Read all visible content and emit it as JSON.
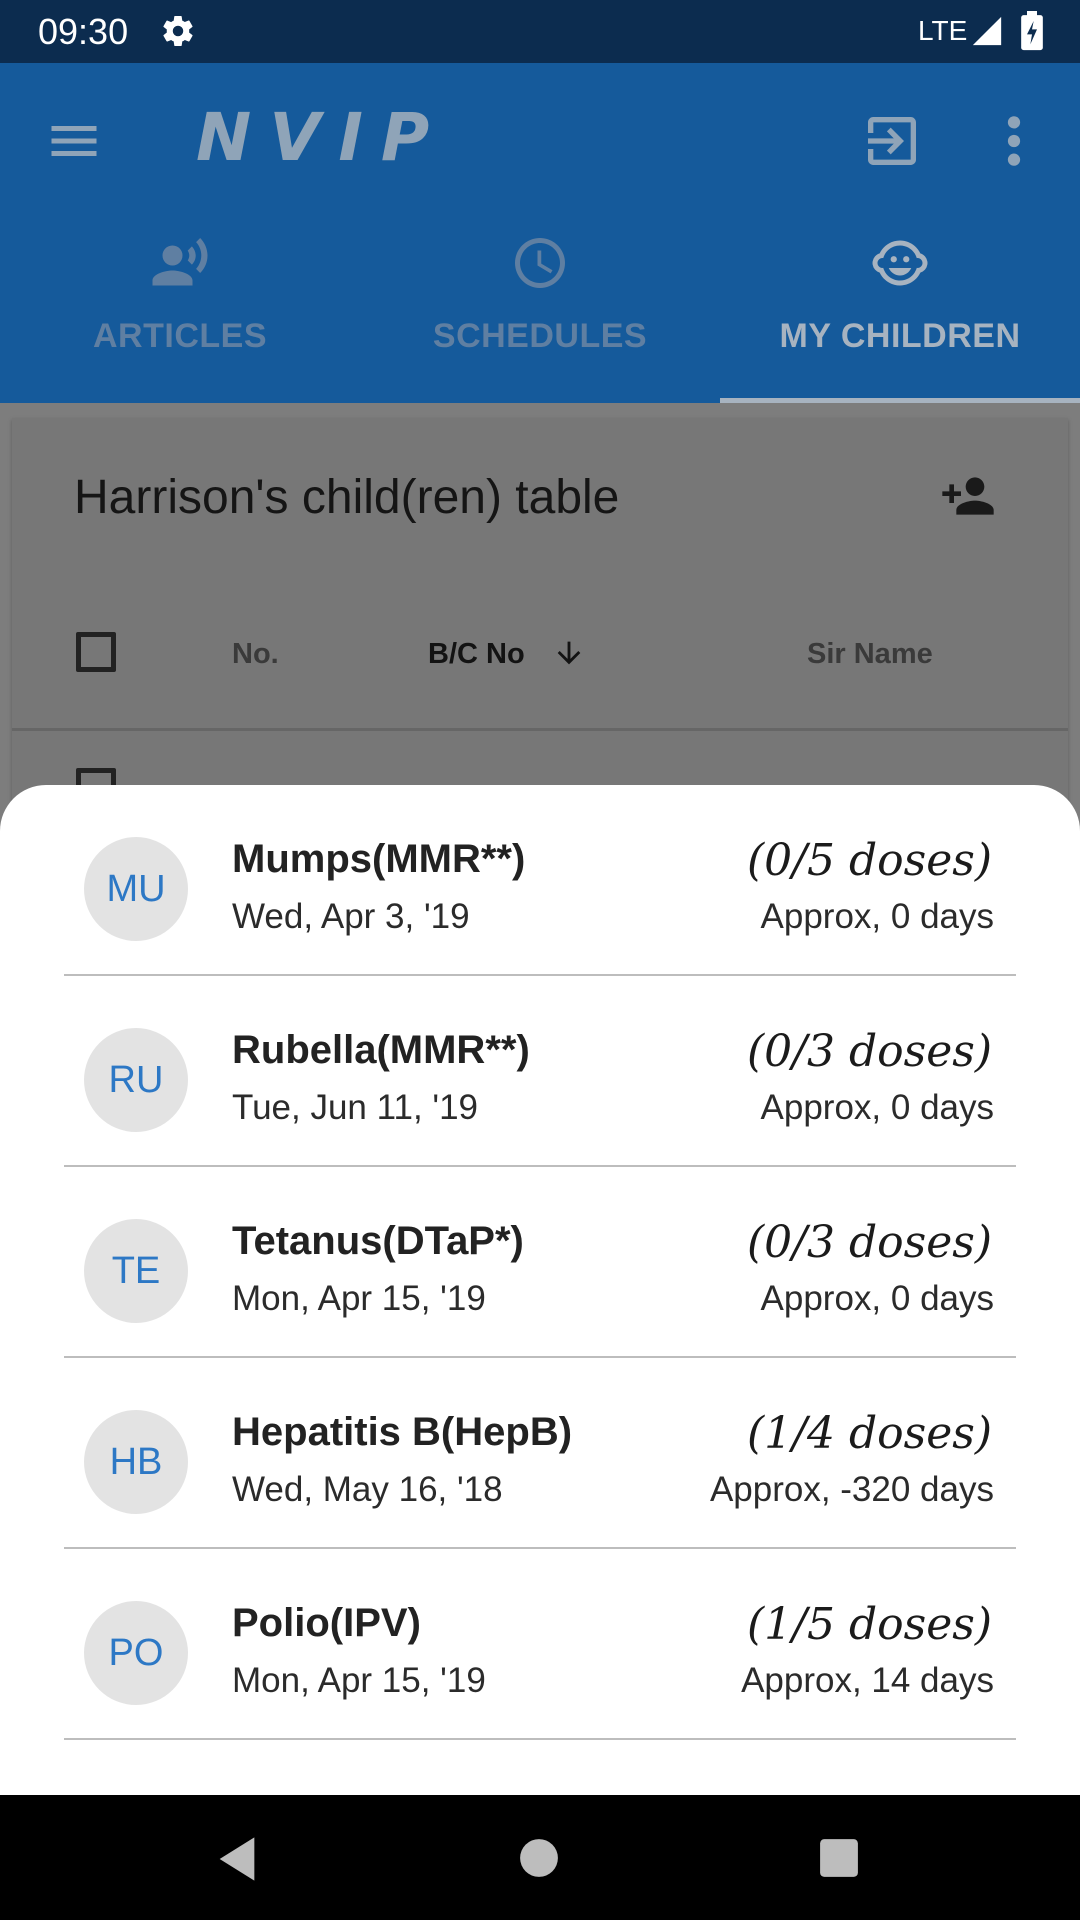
{
  "status_bar": {
    "time": "09:30",
    "network": "LTE",
    "icons": [
      "gear-icon",
      "signal-icon",
      "battery-icon"
    ]
  },
  "app_bar": {
    "logo": "NVIP",
    "icons": [
      "menu-icon",
      "logout-icon",
      "overflow-menu-icon"
    ]
  },
  "tabs": [
    {
      "label": "ARTICLES",
      "icon": "speaker-person-icon",
      "selected": false
    },
    {
      "label": "SCHEDULES",
      "icon": "clock-icon",
      "selected": false
    },
    {
      "label": "MY CHILDREN",
      "icon": "baby-face-icon",
      "selected": true
    }
  ],
  "card": {
    "title": "Harrison's child(ren) table",
    "columns": [
      "No.",
      "B/C No",
      "Sir Name"
    ],
    "sort_column": "B/C No",
    "sort_direction": "descending"
  },
  "vaccines": [
    {
      "initials": "MU",
      "name": "Mumps(MMR**)",
      "date": "Wed, Apr 3, '19",
      "doses": "(0/5 doses)",
      "approx": "Approx, 0 days"
    },
    {
      "initials": "RU",
      "name": "Rubella(MMR**)",
      "date": "Tue, Jun 11, '19",
      "doses": "(0/3 doses)",
      "approx": "Approx, 0 days"
    },
    {
      "initials": "TE",
      "name": "Tetanus(DTaP*)",
      "date": "Mon, Apr 15, '19",
      "doses": "(0/3 doses)",
      "approx": "Approx, 0 days"
    },
    {
      "initials": "HB",
      "name": "Hepatitis B(HepB)",
      "date": "Wed, May 16, '18",
      "doses": "(1/4 doses)",
      "approx": "Approx, -320 days"
    },
    {
      "initials": "PO",
      "name": "Polio(IPV)",
      "date": "Mon, Apr 15, '19",
      "doses": "(1/5 doses)",
      "approx": "Approx, 14 days"
    }
  ],
  "colors": {
    "status_bar": "#0c2c4f",
    "app_bar": "#155a9b",
    "accent_avatar_text": "#2d78c5",
    "scrim": "#7d7d7d"
  }
}
